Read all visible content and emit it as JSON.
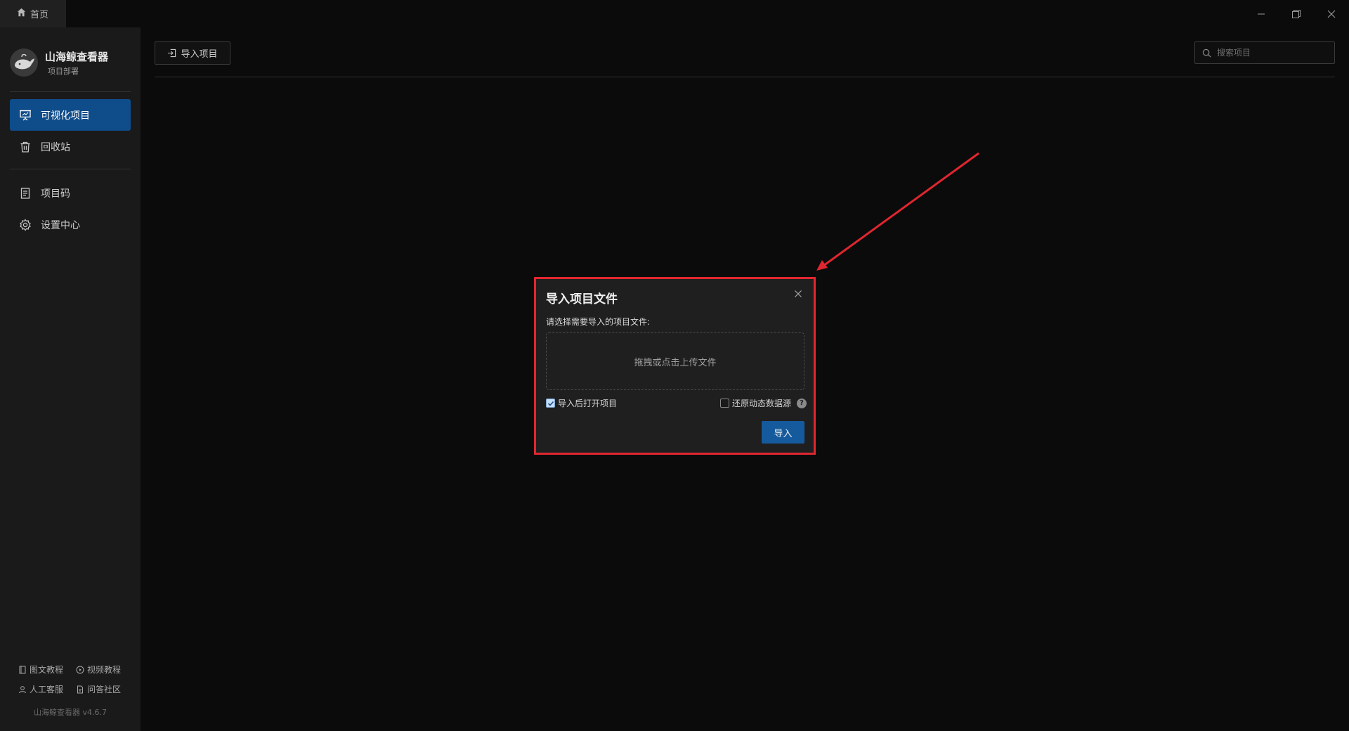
{
  "titlebar": {
    "home_tab_label": "首页",
    "icons": [
      "home-icon",
      "minimize-icon",
      "restore-icon",
      "close-icon"
    ]
  },
  "sidebar": {
    "brand_title": "山海鲸查看器",
    "brand_subtitle": "项目部署",
    "items": [
      {
        "label": "可视化项目",
        "icon": "presentation-icon",
        "active": true
      },
      {
        "label": "回收站",
        "icon": "trash-icon",
        "active": false
      },
      {
        "label": "项目码",
        "icon": "document-icon",
        "active": false
      },
      {
        "label": "设置中心",
        "icon": "gear-icon",
        "active": false
      }
    ],
    "footer_links": [
      {
        "label": "图文教程",
        "icon": "book-icon"
      },
      {
        "label": "视频教程",
        "icon": "play-icon"
      },
      {
        "label": "人工客服",
        "icon": "user-icon"
      },
      {
        "label": "问答社区",
        "icon": "doc-icon"
      }
    ],
    "version": "山海鲸查看器 v4.6.7"
  },
  "toolbar": {
    "import_label": "导入项目",
    "search_placeholder": "搜索项目"
  },
  "modal": {
    "title": "导入项目文件",
    "prompt": "请选择需要导入的项目文件:",
    "dropzone_text": "拖拽或点击上传文件",
    "open_after_import_label": "导入后打开项目",
    "open_after_import_checked": true,
    "restore_datasource_label": "还原动态数据源",
    "restore_datasource_checked": false,
    "help_glyph": "?",
    "confirm_label": "导入"
  },
  "colors": {
    "accent": "#0f4c8a",
    "button_primary": "#155a9c",
    "highlight": "#e0262f",
    "sidebar_bg": "#1a1a1a",
    "app_bg": "#0b0b0b"
  }
}
